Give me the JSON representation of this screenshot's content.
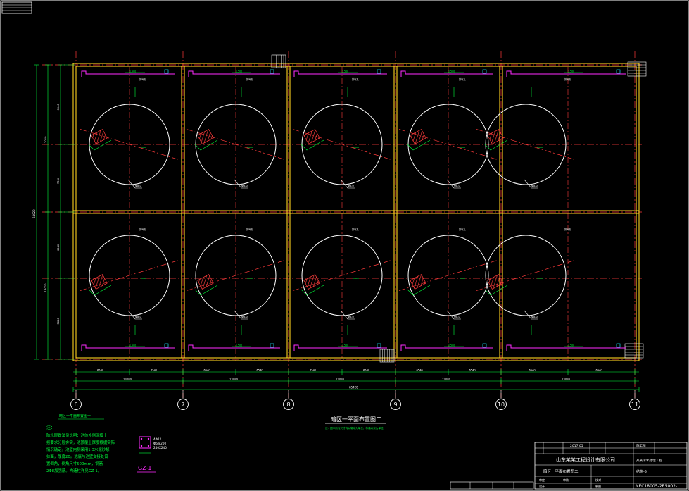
{
  "drawing": {
    "caption": "暗区一平面布置图二",
    "caption_note": "注：图中所有尺寸均以毫米为单位，标高以米为单位。",
    "left_caption": "暗区一平面布置图一",
    "column_label": "GZ-1",
    "column_spec": [
      "4Φ12",
      "Φ6@200",
      "240X240"
    ],
    "overall_width": "65420",
    "overall_height": "34020",
    "bay_labels": [
      "13080",
      "13080",
      "13080",
      "13080",
      "13080"
    ],
    "half_bays": [
      "6540",
      "6540",
      "6540",
      "6540",
      "6540",
      "6540",
      "6540",
      "6540",
      "6540",
      "6540"
    ],
    "left_dims": [
      "17010",
      "17010"
    ],
    "left_sub": [
      "6940",
      "7860",
      "6940",
      "5850"
    ],
    "axis_labels": [
      "6",
      "7",
      "8",
      "9",
      "10",
      "11"
    ],
    "tank_label": "Ф8.0",
    "sump_label": "1.500",
    "vent_label": "排气孔",
    "notes_title": "注：",
    "notes": [
      "防水层做法见说明；池体外侧回填土",
      "按要求分层夯实，池顶覆土厚度根据实际",
      "情况确定。池壁内侧采用1:3水泥砂浆",
      "抹面，厚度20。池底与池壁交接处设",
      "置倒角，倒角尺寸500mm，钢筋",
      "2Φ8加强筋。构造柱详见GZ-1。"
    ]
  },
  "title_block": {
    "company": "山东某某工程设计有限公司",
    "drawing_name": "暗区一平面布置图二",
    "project": "某某污水处理工程",
    "sheet": "结施-5",
    "drawing_no": "NEC18005-2R5002-",
    "stage": "施工图",
    "date": "2017.05",
    "rows": [
      "审定",
      "审核",
      "校对",
      "设计",
      "制图"
    ]
  },
  "colors": {
    "background": "#000000",
    "grid": "#ff3b3b",
    "wall": "#ffd21f",
    "dim": "#00ff3c",
    "circle": "#ffffff",
    "magenta": "#ff2bff",
    "cyan": "#19e6ff",
    "text": "#ffffff"
  }
}
